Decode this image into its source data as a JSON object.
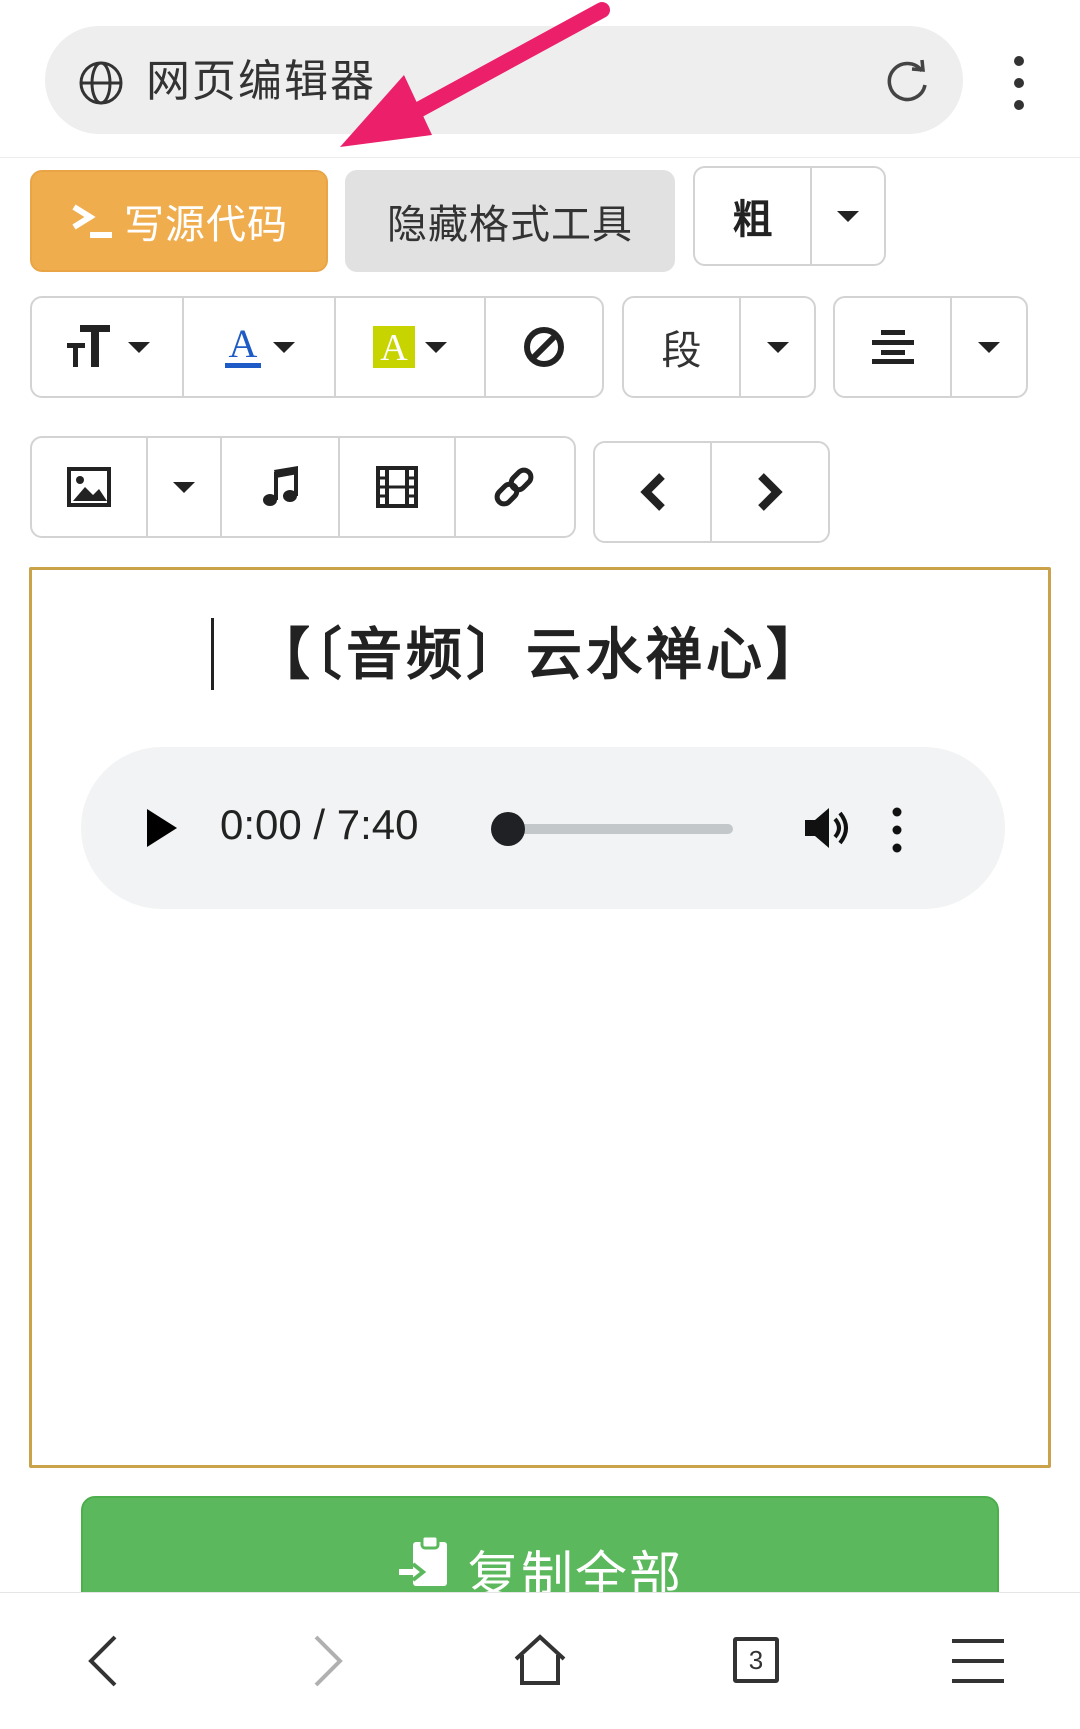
{
  "browser": {
    "address_text": "网页编辑器",
    "icons": [
      "globe-icon",
      "reload-icon",
      "more-vertical-icon"
    ]
  },
  "toolbar": {
    "source_code_label": "写源代码",
    "hide_format_label": "隐藏格式工具",
    "bold_label": "粗",
    "paragraph_label": "段",
    "colors": {
      "warning": "#f0ad4e",
      "success": "#5cb85c",
      "font_color": "#1e5bc6",
      "highlight": "#c8d400"
    }
  },
  "editor": {
    "heading": "【〔音频〕云水禅心】",
    "audio": {
      "time": "0:00 / 7:40",
      "progress": 0
    },
    "border_color": "#c9a24a"
  },
  "actions": {
    "copy_all_label": "复制全部"
  },
  "bottom_nav": {
    "tab_count": "3",
    "icons": [
      "back-icon",
      "forward-icon",
      "home-icon",
      "tabs-icon",
      "menu-icon"
    ]
  }
}
